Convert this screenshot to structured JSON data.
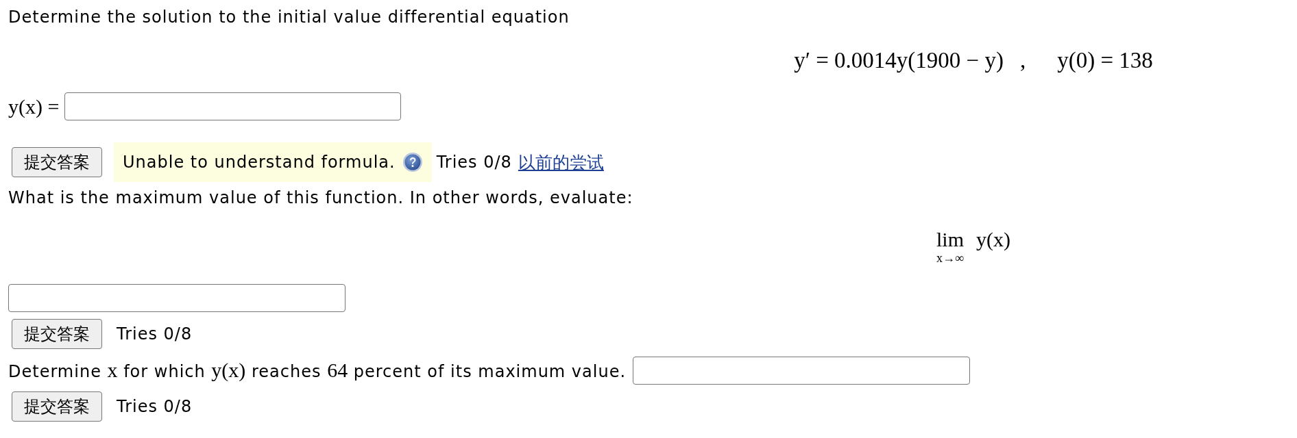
{
  "intro": "Determine the solution to the initial value differential equation",
  "equation": {
    "differential": "y′ = 0.0014y(1900 − y)",
    "separator": ",",
    "initial_condition": "y(0) = 138"
  },
  "answer_1": {
    "label": "y(x) =",
    "submit": "提交答案",
    "feedback": "Unable to understand formula.",
    "tries": "Tries 0/8",
    "previous_attempts_link": "以前的尝试"
  },
  "question_2": {
    "text": "What is the maximum value of this function. In other words, evaluate:",
    "limit": {
      "operator": "lim",
      "subscript": "x→∞",
      "expression": "y(x)"
    },
    "submit": "提交答案",
    "tries": "Tries 0/8"
  },
  "question_3": {
    "prompt_parts": [
      {
        "kind": "text",
        "text": "Determine"
      },
      {
        "kind": "math",
        "text": "x"
      },
      {
        "kind": "text",
        "text": "for which"
      },
      {
        "kind": "math",
        "text": "y(x)"
      },
      {
        "kind": "text",
        "text": "reaches"
      },
      {
        "kind": "math",
        "text": "64"
      },
      {
        "kind": "text",
        "text": "percent of its maximum value."
      }
    ],
    "submit": "提交答案",
    "tries": "Tries 0/8"
  }
}
